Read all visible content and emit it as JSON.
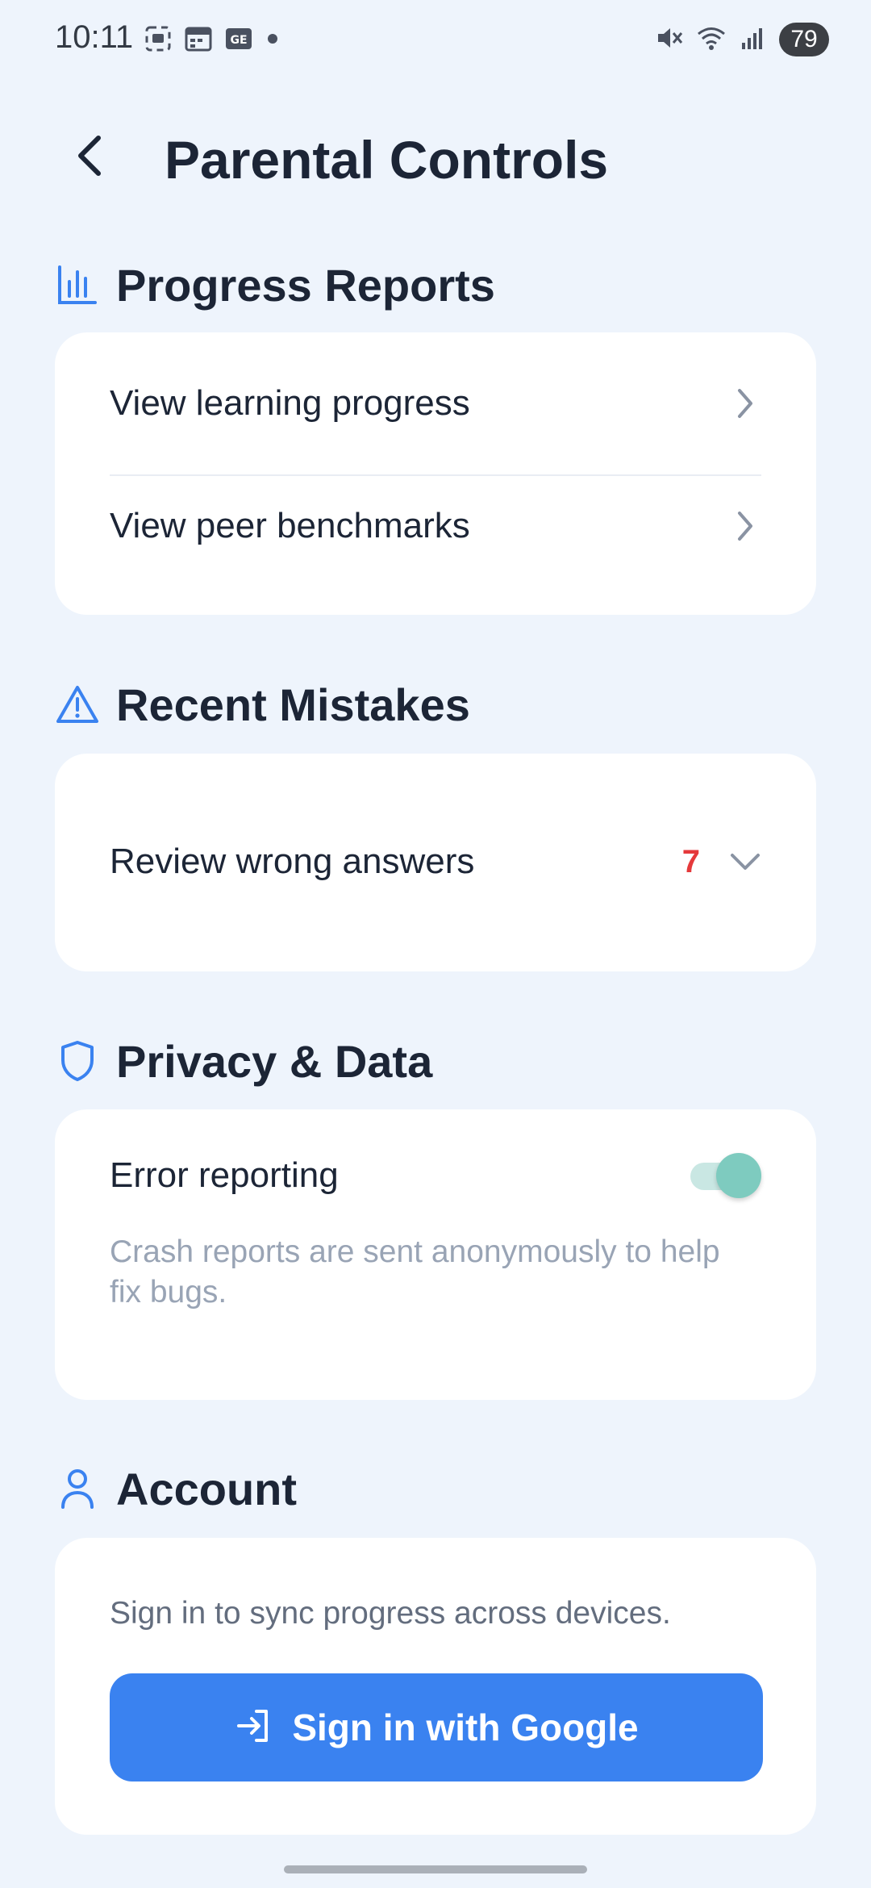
{
  "status_bar": {
    "time": "10:11",
    "battery": "79",
    "icons": [
      "screenshot-icon",
      "calendar-icon",
      "ge-app-icon",
      "notification-dot-icon",
      "mute-icon",
      "wifi-icon",
      "signal-icon"
    ]
  },
  "header": {
    "title": "Parental Controls",
    "back_icon": "chevron-left-icon"
  },
  "sections": {
    "progress": {
      "title": "Progress Reports",
      "icon": "bar-chart-icon",
      "items": [
        {
          "label": "View learning progress",
          "icon": "chevron-right-icon"
        },
        {
          "label": "View peer benchmarks",
          "icon": "chevron-right-icon"
        }
      ]
    },
    "mistakes": {
      "title": "Recent Mistakes",
      "icon": "warning-icon",
      "item": {
        "label": "Review wrong answers",
        "count": "7",
        "icon": "chevron-down-icon"
      }
    },
    "privacy": {
      "title": "Privacy & Data",
      "icon": "shield-icon",
      "item": {
        "label": "Error reporting",
        "enabled": true
      },
      "helper": "Crash reports are sent anonymously to help fix bugs."
    },
    "account": {
      "title": "Account",
      "icon": "user-icon",
      "description": "Sign in to sync progress across devices.",
      "button_label": "Sign in with Google",
      "button_icon": "sign-in-icon"
    }
  },
  "colors": {
    "background": "#eef4fc",
    "accent": "#3a82f0",
    "toggle_on": "#7ecbbf",
    "badge_red": "#e5393b"
  }
}
